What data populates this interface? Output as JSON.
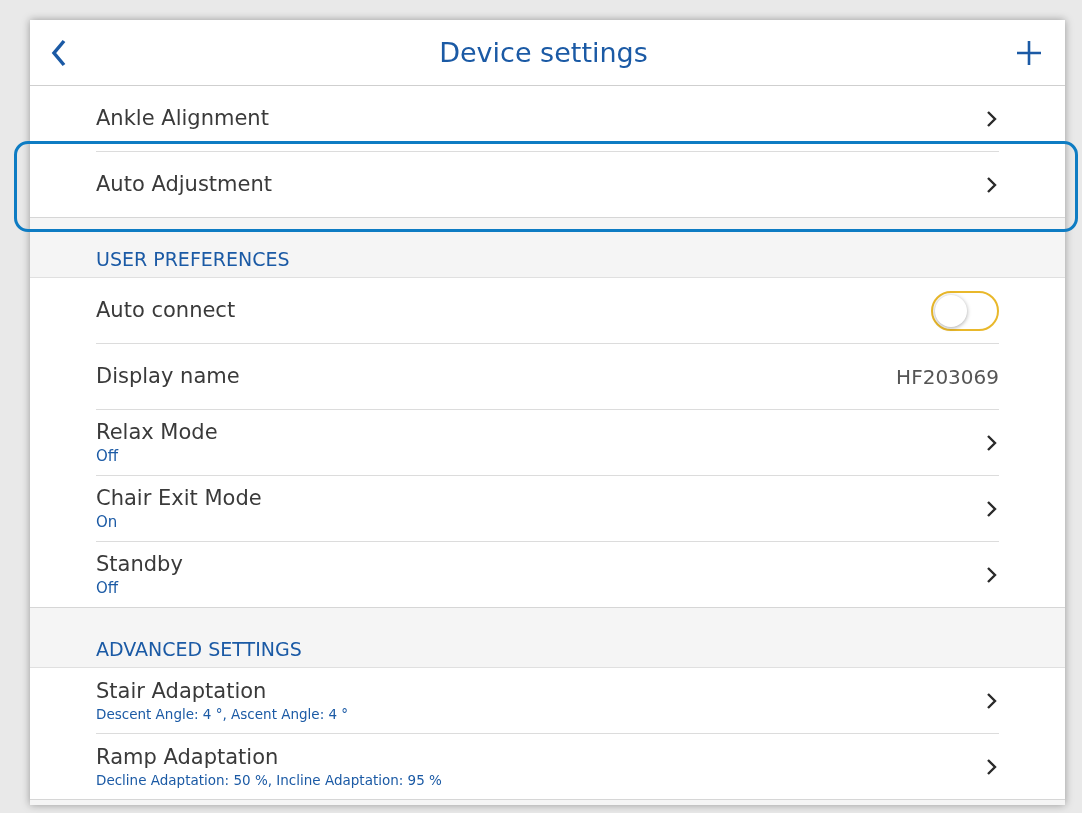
{
  "header": {
    "title": "Device settings"
  },
  "sections": [
    {
      "items": [
        {
          "kind": "link",
          "label": "Ankle Alignment",
          "highlighted": false
        },
        {
          "kind": "link",
          "label": "Auto Adjustment",
          "highlighted": true
        }
      ]
    },
    {
      "title": "USER PREFERENCES",
      "items": [
        {
          "kind": "toggle",
          "label": "Auto connect",
          "on": false
        },
        {
          "kind": "value",
          "label": "Display name",
          "value": "HF203069"
        },
        {
          "kind": "link",
          "label": "Relax Mode",
          "subtitle": "Off"
        },
        {
          "kind": "link",
          "label": "Chair Exit Mode",
          "subtitle": "On"
        },
        {
          "kind": "link",
          "label": "Standby",
          "subtitle": "Off"
        }
      ]
    },
    {
      "title": "ADVANCED SETTINGS",
      "items": [
        {
          "kind": "link",
          "label": "Stair Adaptation",
          "subtitle": "Descent Angle: 4 °, Ascent Angle: 4 °"
        },
        {
          "kind": "link",
          "label": "Ramp Adaptation",
          "subtitle": "Decline Adaptation: 50 %, Incline Adaptation: 95 %"
        }
      ]
    }
  ]
}
